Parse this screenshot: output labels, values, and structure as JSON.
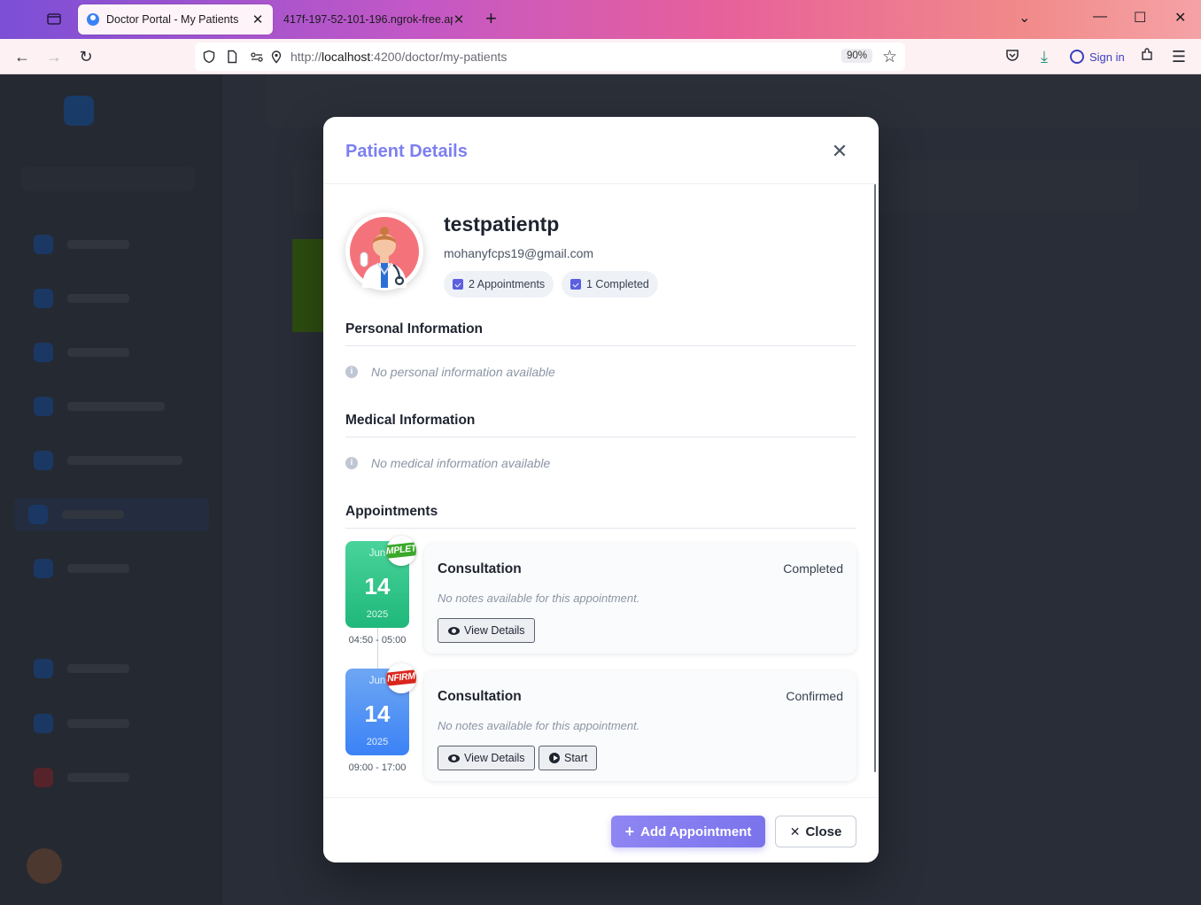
{
  "browser": {
    "tabs": [
      {
        "title": "Doctor Portal - My Patients",
        "active": true
      },
      {
        "title": "417f-197-52-101-196.ngrok-free.ap",
        "active": false
      }
    ],
    "url_prefix": "http://",
    "url_host": "localhost",
    "url_path": ":4200/doctor/my-patients",
    "zoom": "90%",
    "sign_in_label": "Sign in"
  },
  "modal": {
    "title": "Patient Details",
    "patient": {
      "name": "testpatientp",
      "email": "mohanyfcps19@gmail.com",
      "appointments_pill": "2 Appointments",
      "completed_pill": "1 Completed"
    },
    "personal_section": {
      "title": "Personal Information",
      "empty_text": "No personal information available"
    },
    "medical_section": {
      "title": "Medical Information",
      "empty_text": "No medical information available"
    },
    "appointments_section": {
      "title": "Appointments",
      "items": [
        {
          "month": "Jun",
          "day": "14",
          "year": "2025",
          "time": "04:50 - 05:00",
          "sticker": "MPLET",
          "type": "Consultation",
          "status": "Completed",
          "notes": "No notes available for this appointment.",
          "view_label": "View Details"
        },
        {
          "month": "Jun",
          "day": "14",
          "year": "2025",
          "time": "09:00 - 17:00",
          "sticker": "NFIRM",
          "type": "Consultation",
          "status": "Confirmed",
          "notes": "No notes available for this appointment.",
          "view_label": "View Details",
          "start_label": "Start"
        }
      ]
    },
    "footer": {
      "add_label": "Add Appointment",
      "close_label": "Close"
    }
  },
  "colors": {
    "accent": "#7c7ff0",
    "completed": "#1fb87a",
    "confirmed": "#3b82f6"
  }
}
